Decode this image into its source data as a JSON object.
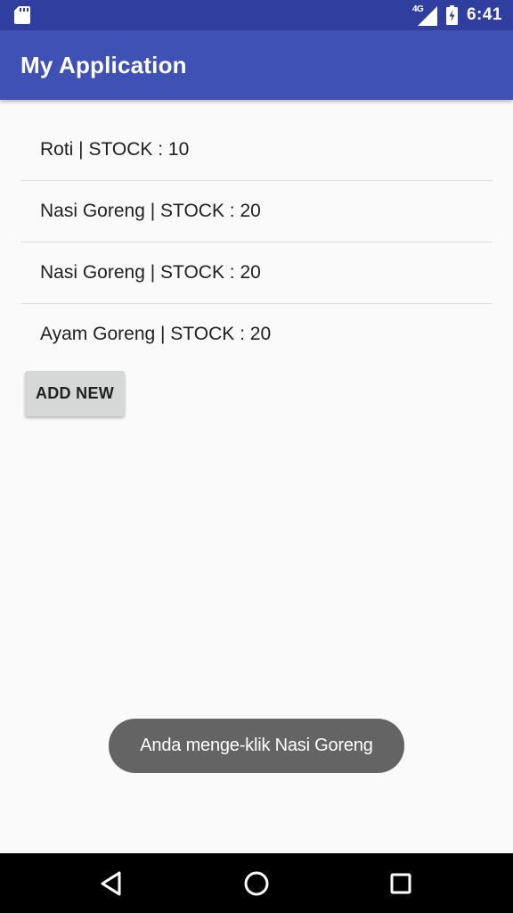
{
  "status_bar": {
    "network_label": "4G",
    "time": "6:41",
    "icons": [
      "sd-card-icon",
      "signal-icon",
      "battery-icon"
    ]
  },
  "app_bar": {
    "title": "My Application"
  },
  "list": {
    "items": [
      {
        "label": "Roti | STOCK : 10"
      },
      {
        "label": "Nasi Goreng | STOCK : 20"
      },
      {
        "label": "Nasi Goreng | STOCK : 20"
      },
      {
        "label": "Ayam Goreng | STOCK : 20"
      }
    ]
  },
  "actions": {
    "add_new_label": "ADD NEW"
  },
  "toast": {
    "message": "Anda menge-klik Nasi Goreng"
  },
  "nav_bar": {
    "icons": [
      "back-icon",
      "home-icon",
      "recents-icon"
    ]
  },
  "colors": {
    "status_bar": "#303f9f",
    "app_bar": "#3f51b5",
    "background": "#fafafa",
    "button": "#d6d7d7",
    "toast": "#646464",
    "nav_bar": "#000000"
  }
}
